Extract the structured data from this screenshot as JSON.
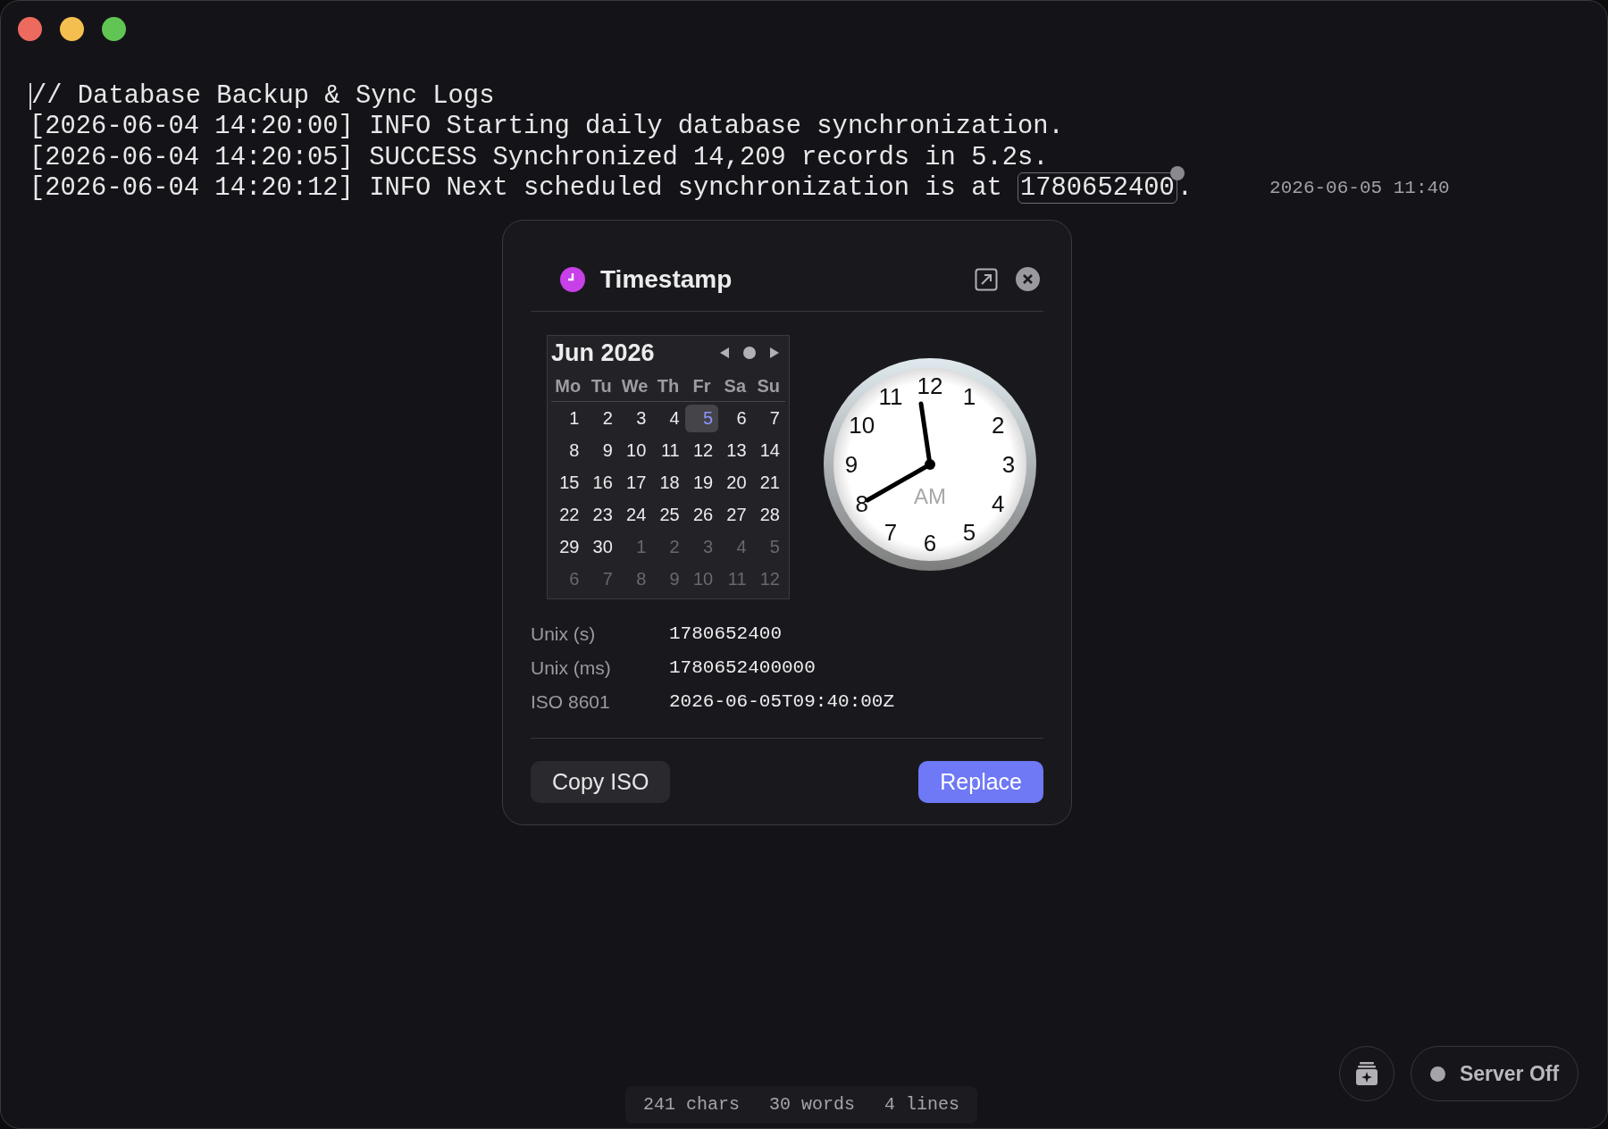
{
  "window": {
    "controls": [
      {
        "color": "#ed6a5e"
      },
      {
        "color": "#f4bf4f"
      },
      {
        "color": "#61c554"
      }
    ]
  },
  "editor": {
    "lines": [
      {
        "cursor": true,
        "segments": [
          {
            "text": "// Database Backup & Sync Logs",
            "highlighted": false
          }
        ]
      },
      {
        "cursor": false,
        "segments": [
          {
            "text": "[2026-06-04 14:20:00] INFO Starting daily database synchronization.",
            "highlighted": false
          }
        ]
      },
      {
        "cursor": false,
        "segments": [
          {
            "text": "[2026-06-04 14:20:05] SUCCESS Synchronized 14,209 records in 5.2s.",
            "highlighted": false
          }
        ]
      },
      {
        "cursor": false,
        "segments": [
          {
            "text": "[2026-06-04 14:20:12] INFO Next scheduled synchronization is at ",
            "highlighted": false
          },
          {
            "text": "1780652400",
            "highlighted": true
          },
          {
            "text": ".",
            "highlighted": false
          }
        ],
        "hint": "2026-06-05 11:40"
      }
    ]
  },
  "popup": {
    "title": "Timestamp",
    "calendar": {
      "month": "Jun 2026",
      "weekdays": [
        "Mo",
        "Tu",
        "We",
        "Th",
        "Fr",
        "Sa",
        "Su"
      ],
      "weeks": [
        [
          {
            "day": "1",
            "in_month": true,
            "selected": false
          },
          {
            "day": "2",
            "in_month": true,
            "selected": false
          },
          {
            "day": "3",
            "in_month": true,
            "selected": false
          },
          {
            "day": "4",
            "in_month": true,
            "selected": false
          },
          {
            "day": "5",
            "in_month": true,
            "selected": true
          },
          {
            "day": "6",
            "in_month": true,
            "selected": false
          },
          {
            "day": "7",
            "in_month": true,
            "selected": false
          }
        ],
        [
          {
            "day": "8",
            "in_month": true,
            "selected": false
          },
          {
            "day": "9",
            "in_month": true,
            "selected": false
          },
          {
            "day": "10",
            "in_month": true,
            "selected": false
          },
          {
            "day": "11",
            "in_month": true,
            "selected": false
          },
          {
            "day": "12",
            "in_month": true,
            "selected": false
          },
          {
            "day": "13",
            "in_month": true,
            "selected": false
          },
          {
            "day": "14",
            "in_month": true,
            "selected": false
          }
        ],
        [
          {
            "day": "15",
            "in_month": true,
            "selected": false
          },
          {
            "day": "16",
            "in_month": true,
            "selected": false
          },
          {
            "day": "17",
            "in_month": true,
            "selected": false
          },
          {
            "day": "18",
            "in_month": true,
            "selected": false
          },
          {
            "day": "19",
            "in_month": true,
            "selected": false
          },
          {
            "day": "20",
            "in_month": true,
            "selected": false
          },
          {
            "day": "21",
            "in_month": true,
            "selected": false
          }
        ],
        [
          {
            "day": "22",
            "in_month": true,
            "selected": false
          },
          {
            "day": "23",
            "in_month": true,
            "selected": false
          },
          {
            "day": "24",
            "in_month": true,
            "selected": false
          },
          {
            "day": "25",
            "in_month": true,
            "selected": false
          },
          {
            "day": "26",
            "in_month": true,
            "selected": false
          },
          {
            "day": "27",
            "in_month": true,
            "selected": false
          },
          {
            "day": "28",
            "in_month": true,
            "selected": false
          }
        ],
        [
          {
            "day": "29",
            "in_month": true,
            "selected": false
          },
          {
            "day": "30",
            "in_month": true,
            "selected": false
          },
          {
            "day": "1",
            "in_month": false,
            "selected": false
          },
          {
            "day": "2",
            "in_month": false,
            "selected": false
          },
          {
            "day": "3",
            "in_month": false,
            "selected": false
          },
          {
            "day": "4",
            "in_month": false,
            "selected": false
          },
          {
            "day": "5",
            "in_month": false,
            "selected": false
          }
        ],
        [
          {
            "day": "6",
            "in_month": false,
            "selected": false
          },
          {
            "day": "7",
            "in_month": false,
            "selected": false
          },
          {
            "day": "8",
            "in_month": false,
            "selected": false
          },
          {
            "day": "9",
            "in_month": false,
            "selected": false
          },
          {
            "day": "10",
            "in_month": false,
            "selected": false
          },
          {
            "day": "11",
            "in_month": false,
            "selected": false
          },
          {
            "day": "12",
            "in_month": false,
            "selected": false
          }
        ]
      ]
    },
    "clock": {
      "numerals": [
        "12",
        "11",
        "1",
        "10",
        "2",
        "9",
        "3",
        "8",
        "4",
        "7",
        "5",
        "6"
      ],
      "period": "AM"
    },
    "fields": [
      {
        "label": "Unix (s)",
        "value": "1780652400"
      },
      {
        "label": "Unix (ms)",
        "value": "1780652400000"
      },
      {
        "label": "ISO 8601",
        "value": "2026-06-05T09:40:00Z"
      }
    ],
    "buttons": [
      {
        "label": "Copy ISO",
        "kind": "secondary"
      },
      {
        "label": "Replace",
        "kind": "primary"
      }
    ]
  },
  "status": {
    "stats": [
      "241 chars",
      "30 words",
      "4 lines"
    ],
    "server": {
      "label": "Server Off",
      "on": false
    }
  }
}
